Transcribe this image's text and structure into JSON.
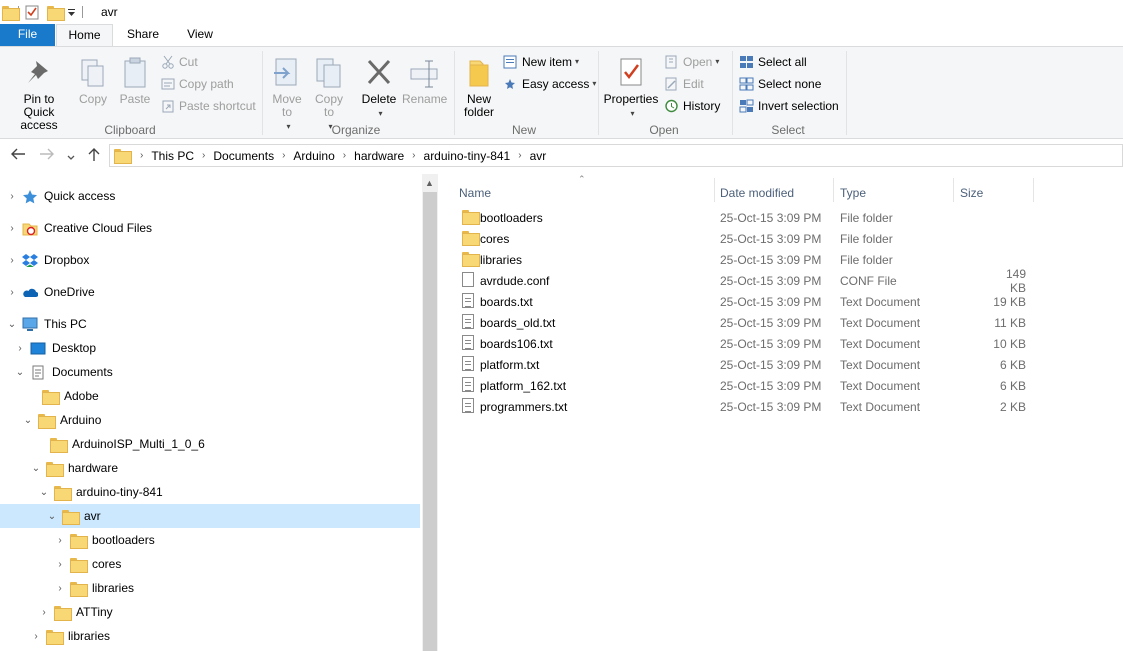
{
  "window": {
    "title": "avr"
  },
  "tabs": {
    "file": "File",
    "home": "Home",
    "share": "Share",
    "view": "View"
  },
  "ribbon": {
    "clipboard": {
      "label": "Clipboard",
      "pin": "Pin to Quick access",
      "copy": "Copy",
      "paste": "Paste",
      "cut": "Cut",
      "copy_path": "Copy path",
      "paste_shortcut": "Paste shortcut"
    },
    "organize": {
      "label": "Organize",
      "move_to": "Move to",
      "copy_to": "Copy to",
      "delete": "Delete",
      "rename": "Rename"
    },
    "new": {
      "label": "New",
      "new_folder": "New folder",
      "new_item": "New item",
      "easy_access": "Easy access"
    },
    "open": {
      "label": "Open",
      "properties": "Properties",
      "open": "Open",
      "edit": "Edit",
      "history": "History"
    },
    "select": {
      "label": "Select",
      "select_all": "Select all",
      "select_none": "Select none",
      "invert": "Invert selection"
    }
  },
  "address": {
    "crumbs": [
      "This PC",
      "Documents",
      "Arduino",
      "hardware",
      "arduino-tiny-841",
      "avr"
    ]
  },
  "tree": [
    {
      "label": "Quick access",
      "icon": "star-icon"
    },
    {
      "label": "Creative Cloud Files",
      "icon": "creative-cloud-icon"
    },
    {
      "label": "Dropbox",
      "icon": "dropbox-icon"
    },
    {
      "label": "OneDrive",
      "icon": "onedrive-icon"
    },
    {
      "label": "This PC",
      "icon": "computer-icon"
    },
    {
      "label": "Desktop",
      "icon": "desktop-icon"
    },
    {
      "label": "Documents",
      "icon": "documents-icon"
    },
    {
      "label": "Adobe",
      "icon": "folder-icon"
    },
    {
      "label": "Arduino",
      "icon": "folder-icon"
    },
    {
      "label": "ArduinoISP_Multi_1_0_6",
      "icon": "folder-icon"
    },
    {
      "label": "hardware",
      "icon": "folder-icon"
    },
    {
      "label": "arduino-tiny-841",
      "icon": "folder-icon"
    },
    {
      "label": "avr",
      "icon": "folder-icon"
    },
    {
      "label": "bootloaders",
      "icon": "folder-icon"
    },
    {
      "label": "cores",
      "icon": "folder-icon"
    },
    {
      "label": "libraries",
      "icon": "folder-icon"
    },
    {
      "label": "ATTiny",
      "icon": "folder-icon"
    },
    {
      "label": "libraries",
      "icon": "folder-icon"
    }
  ],
  "columns": {
    "name": "Name",
    "date": "Date modified",
    "type": "Type",
    "size": "Size"
  },
  "files": [
    {
      "name": "bootloaders",
      "date": "25-Oct-15 3:09 PM",
      "type": "File folder",
      "size": ""
    },
    {
      "name": "cores",
      "date": "25-Oct-15 3:09 PM",
      "type": "File folder",
      "size": ""
    },
    {
      "name": "libraries",
      "date": "25-Oct-15 3:09 PM",
      "type": "File folder",
      "size": ""
    },
    {
      "name": "avrdude.conf",
      "date": "25-Oct-15 3:09 PM",
      "type": "CONF File",
      "size": "149 KB"
    },
    {
      "name": "boards.txt",
      "date": "25-Oct-15 3:09 PM",
      "type": "Text Document",
      "size": "19 KB"
    },
    {
      "name": "boards_old.txt",
      "date": "25-Oct-15 3:09 PM",
      "type": "Text Document",
      "size": "11 KB"
    },
    {
      "name": "boards106.txt",
      "date": "25-Oct-15 3:09 PM",
      "type": "Text Document",
      "size": "10 KB"
    },
    {
      "name": "platform.txt",
      "date": "25-Oct-15 3:09 PM",
      "type": "Text Document",
      "size": "6 KB"
    },
    {
      "name": "platform_162.txt",
      "date": "25-Oct-15 3:09 PM",
      "type": "Text Document",
      "size": "6 KB"
    },
    {
      "name": "programmers.txt",
      "date": "25-Oct-15 3:09 PM",
      "type": "Text Document",
      "size": "2 KB"
    }
  ]
}
